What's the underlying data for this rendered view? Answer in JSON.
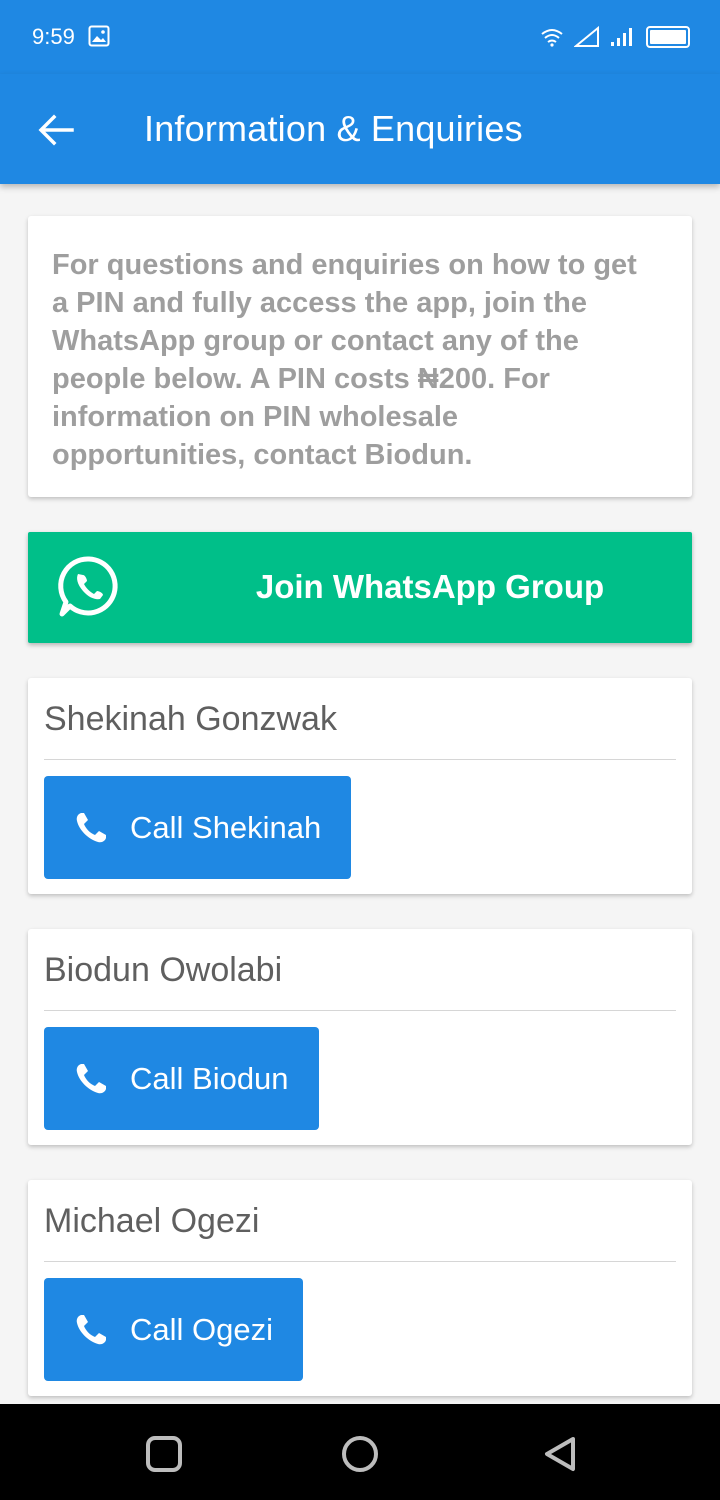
{
  "status_bar": {
    "time": "9:59",
    "icons": [
      "gallery-icon",
      "wifi-icon",
      "signal-icon",
      "signal-bars-icon",
      "battery-icon"
    ]
  },
  "app_bar": {
    "title": "Information & Enquiries",
    "back_icon": "arrow-left-icon"
  },
  "info": {
    "text": "For questions and enquiries on how to get a PIN and fully access the app, join the WhatsApp group or contact any of the people below. A PIN costs ₦200. For information on PIN wholesale opportunities, contact Biodun."
  },
  "whatsapp": {
    "label": "Join WhatsApp Group",
    "icon": "whatsapp-icon",
    "color": "#00bf89"
  },
  "contacts": [
    {
      "name": "Shekinah Gonzwak",
      "button_label": "Call Shekinah"
    },
    {
      "name": "Biodun Owolabi",
      "button_label": "Call Biodun"
    },
    {
      "name": "Michael Ogezi",
      "button_label": "Call Ogezi"
    }
  ],
  "colors": {
    "primary": "#1f88e3",
    "whatsapp": "#00bf89",
    "info_text": "#9e9e9e"
  },
  "nav_bar": {
    "icons": [
      "recents-square-icon",
      "home-circle-icon",
      "back-triangle-icon"
    ]
  }
}
